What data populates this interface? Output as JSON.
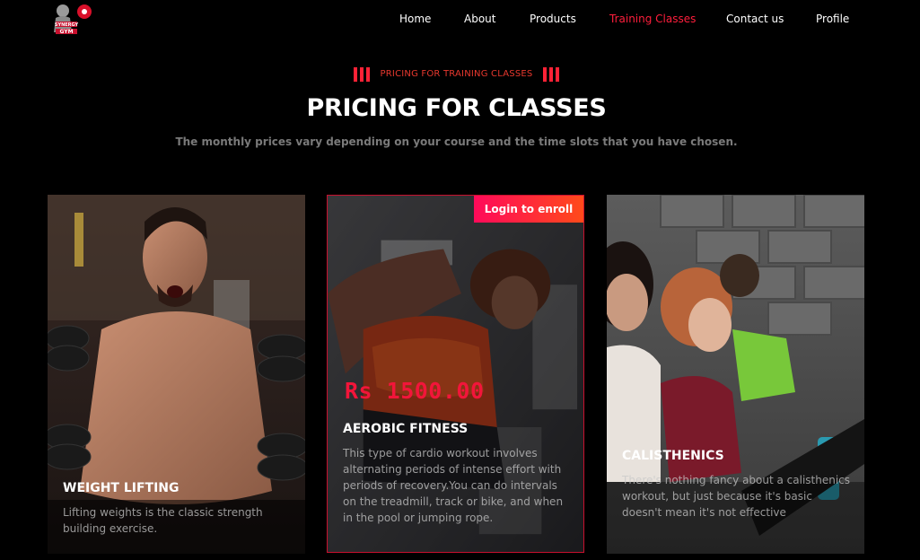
{
  "nav": {
    "logo_text": "SYNERGY GYM",
    "items": [
      "Home",
      "About",
      "Products",
      "Training Classes",
      "Contact us",
      "Profile"
    ],
    "active": "Training Classes"
  },
  "header": {
    "kicker": "PRICING FOR TRAINING CLASSES",
    "title": "PRICING FOR CLASSES",
    "subtitle": "The monthly prices vary depending on your course and the time slots that you have chosen."
  },
  "cards": [
    {
      "title": "WEIGHT LIFTING",
      "description": "Lifting weights is the classic strength building exercise."
    },
    {
      "title": "AEROBIC FITNESS",
      "price": "Rs 1500.00",
      "enroll_label": "Login to enroll",
      "description": "This type of cardio workout involves alternating periods of intense effort with periods of recovery.You can do intervals on the treadmill, track or bike, and when in the pool or jumping rope."
    },
    {
      "title": "CALISTHENICS",
      "description": "There's nothing fancy about a calisthenics workout, but just because it's basic doesn't mean it's not effective"
    }
  ],
  "colors": {
    "accent": "#ff1e3c",
    "background": "#000000"
  }
}
